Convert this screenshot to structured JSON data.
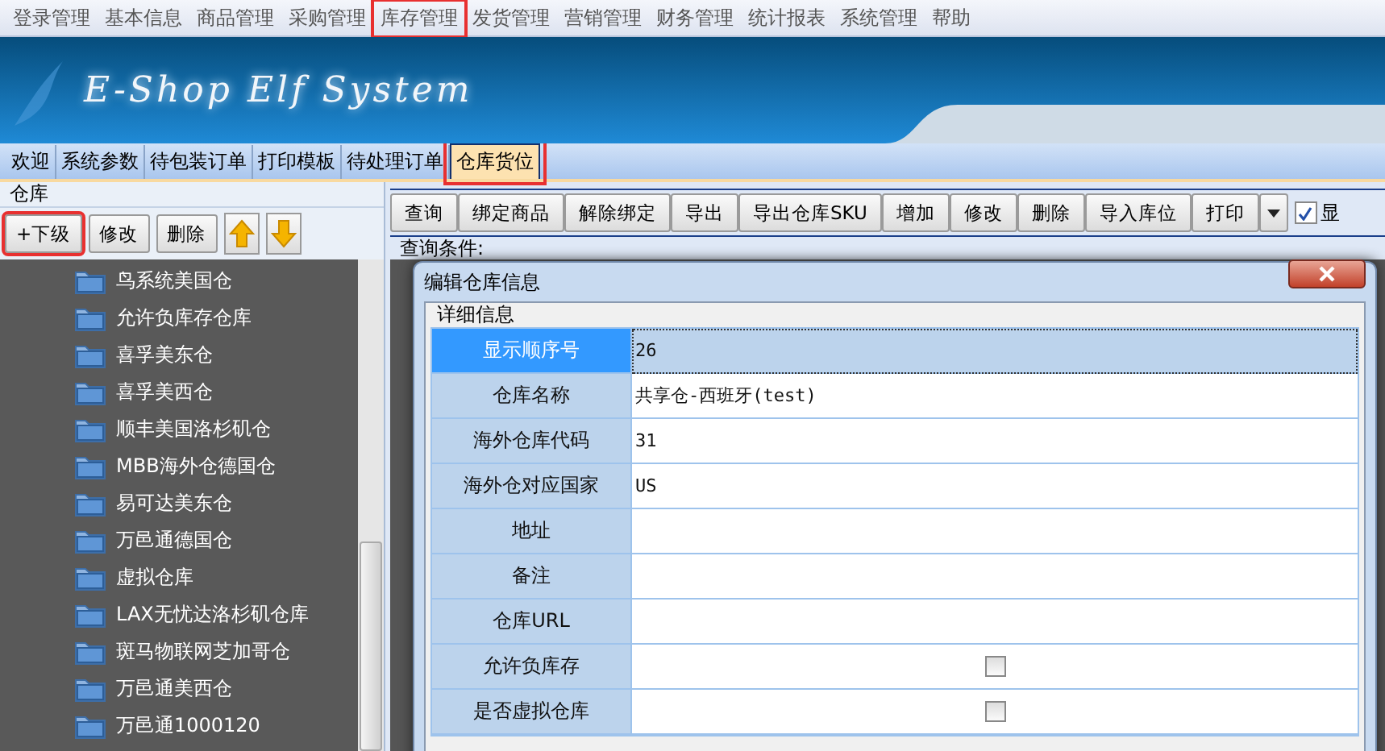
{
  "menu": [
    {
      "label": "登录管理",
      "highlighted": false
    },
    {
      "label": "基本信息",
      "highlighted": false
    },
    {
      "label": "商品管理",
      "highlighted": false
    },
    {
      "label": "采购管理",
      "highlighted": false
    },
    {
      "label": "库存管理",
      "highlighted": true
    },
    {
      "label": "发货管理",
      "highlighted": false
    },
    {
      "label": "营销管理",
      "highlighted": false
    },
    {
      "label": "财务管理",
      "highlighted": false
    },
    {
      "label": "统计报表",
      "highlighted": false
    },
    {
      "label": "系统管理",
      "highlighted": false
    },
    {
      "label": "帮助",
      "highlighted": false
    }
  ],
  "banner": {
    "title": "E-Shop Elf System"
  },
  "tabs": [
    {
      "label": "欢迎",
      "selected": false
    },
    {
      "label": "系统参数",
      "selected": false
    },
    {
      "label": "待包装订单",
      "selected": false
    },
    {
      "label": "打印模板",
      "selected": false
    },
    {
      "label": "待处理订单",
      "selected": false
    },
    {
      "label": "仓库货位",
      "selected": true
    }
  ],
  "left_panel": {
    "title": "仓库",
    "buttons": [
      {
        "label": "+下级",
        "highlighted": true
      },
      {
        "label": "修改",
        "highlighted": false
      },
      {
        "label": "删除",
        "highlighted": false
      }
    ],
    "tree": [
      "鸟系统美国仓",
      "允许负库存仓库",
      "喜孚美东仓",
      "喜孚美西仓",
      "顺丰美国洛杉矶仓",
      "MBB海外仓德国仓",
      "易可达美东仓",
      "万邑通德国仓",
      "虚拟仓库",
      "LAX无忧达洛杉矶仓库",
      "斑马物联网芝加哥仓",
      "万邑通美西仓",
      "万邑通1000120"
    ]
  },
  "toolbar": {
    "buttons": [
      "查询",
      "绑定商品",
      "解除绑定",
      "导出",
      "导出仓库SKU",
      "增加",
      "修改",
      "删除",
      "导入库位",
      "打印"
    ],
    "checkbox": {
      "label": "显",
      "checked": true
    },
    "query_label": "查询条件:"
  },
  "dialog": {
    "title": "编辑仓库信息",
    "group": "详细信息",
    "rows": [
      {
        "label": "显示顺序号",
        "kind": "text",
        "value": "26",
        "selected": true
      },
      {
        "label": "仓库名称",
        "kind": "text",
        "value": "共享仓-西班牙(test)",
        "selected": false
      },
      {
        "label": "海外仓库代码",
        "kind": "text",
        "value": "31",
        "selected": false
      },
      {
        "label": "海外仓对应国家",
        "kind": "text",
        "value": "US",
        "selected": false
      },
      {
        "label": "地址",
        "kind": "text",
        "selected": false
      },
      {
        "label": "备注",
        "kind": "text",
        "selected": false
      },
      {
        "label": "仓库URL",
        "kind": "text",
        "selected": false
      },
      {
        "label": "允许负库存",
        "kind": "checkbox",
        "checked": false,
        "selected": false
      },
      {
        "label": "是否虚拟仓库",
        "kind": "checkbox",
        "checked": false,
        "selected": false
      }
    ]
  }
}
